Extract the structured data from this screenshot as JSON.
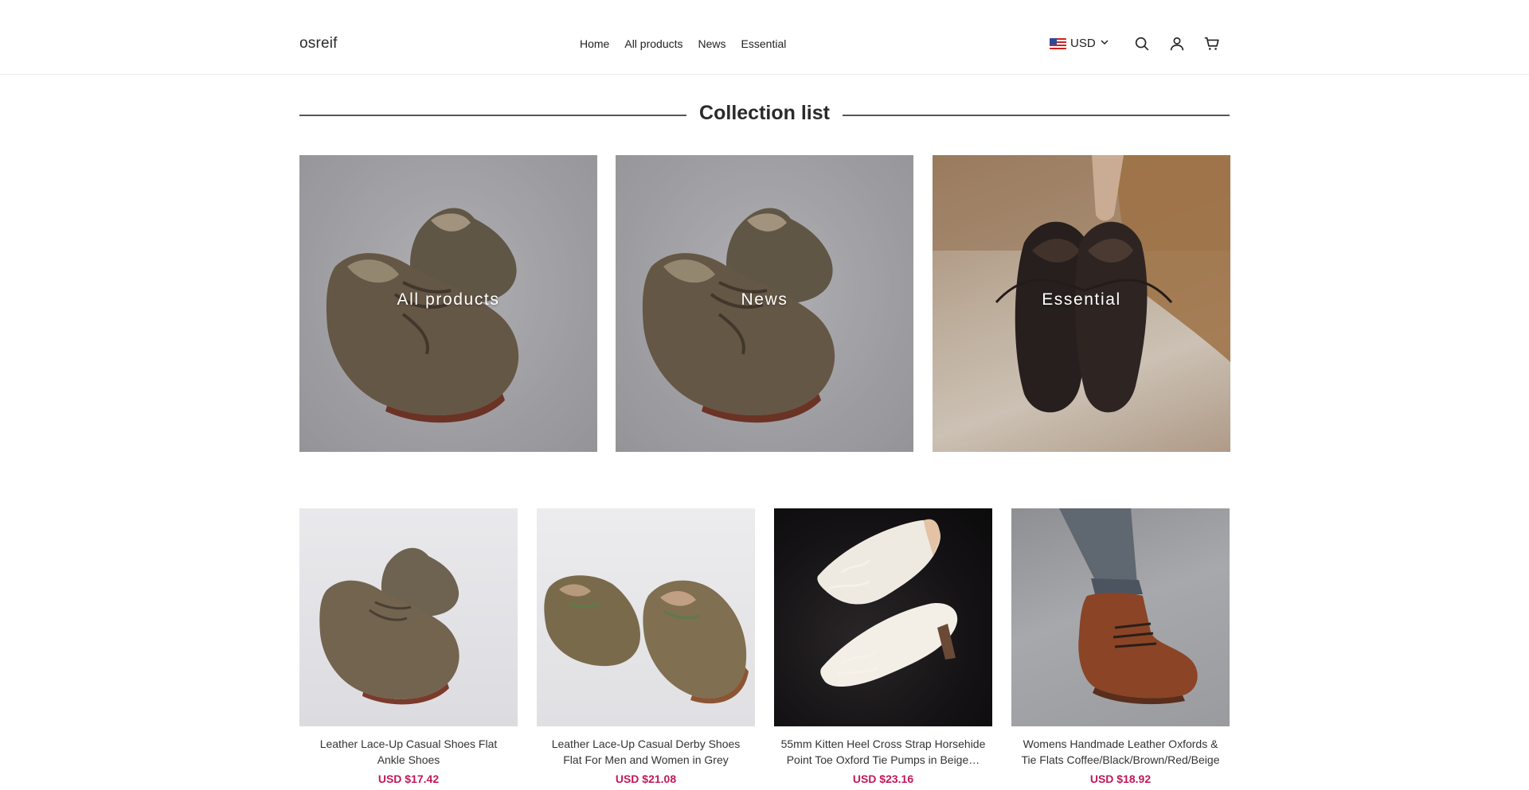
{
  "header": {
    "logo": "osreif",
    "nav": [
      "Home",
      "All products",
      "News",
      "Essential"
    ],
    "currency": "USD",
    "icons": [
      "search-icon",
      "account-icon",
      "cart-icon"
    ]
  },
  "collection": {
    "title": "Collection list",
    "tiles": [
      {
        "label": "All products"
      },
      {
        "label": "News"
      },
      {
        "label": "Essential"
      }
    ]
  },
  "products": [
    {
      "name": "Leather Lace-Up Casual Shoes Flat Ankle Shoes",
      "price": "USD $17.42"
    },
    {
      "name": "Leather Lace-Up Casual Derby Shoes Flat For Men and Women in Grey",
      "price": "USD $21.08"
    },
    {
      "name": "55mm Kitten Heel Cross Strap Horsehide Point Toe Oxford Tie Pumps in Beige…",
      "price": "USD $23.16"
    },
    {
      "name": "Womens Handmade Leather Oxfords & Tie Flats Coffee/Black/Brown/Red/Beige",
      "price": "USD $18.92"
    }
  ],
  "colors": {
    "price": "#c2185b",
    "text": "#222222",
    "border": "#ececec"
  }
}
